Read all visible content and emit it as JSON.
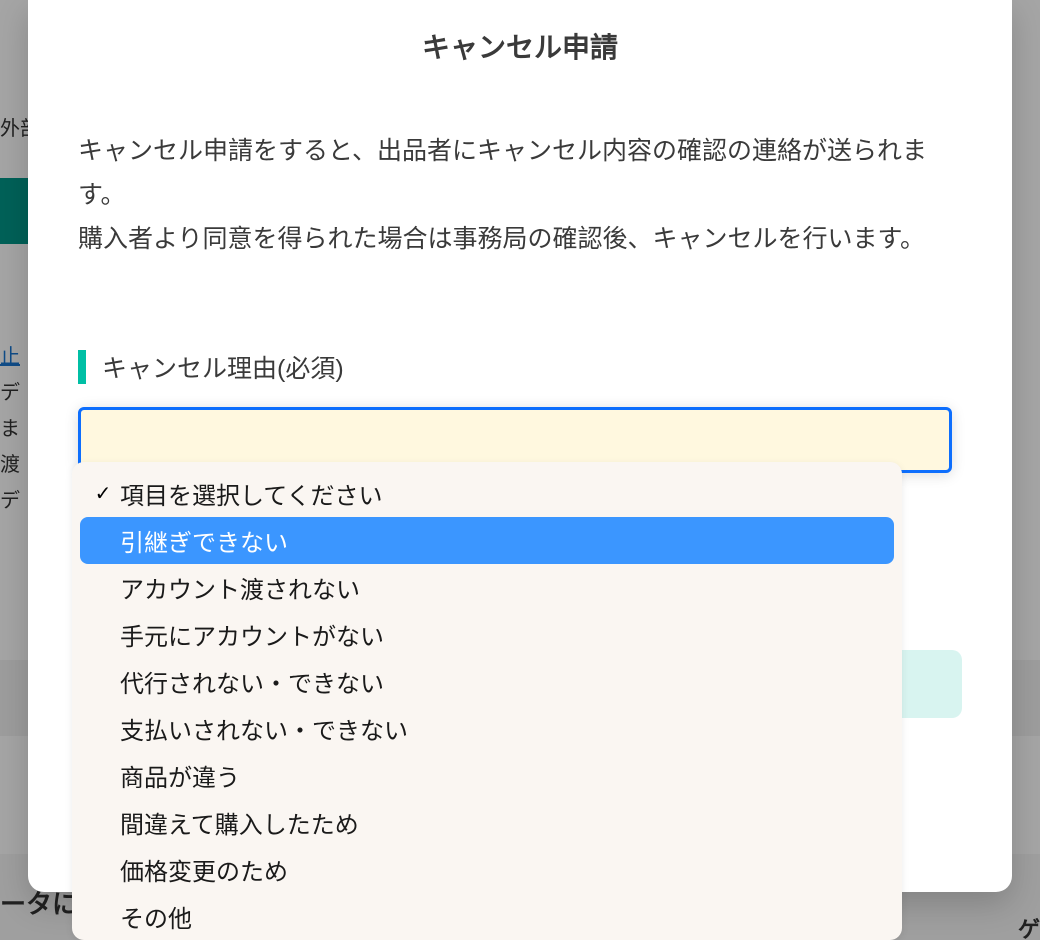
{
  "modal": {
    "title": "キャンセル申請",
    "description_line1": "キャンセル申請をすると、出品者にキャンセル内容の確認の連絡が送られます。",
    "description_line2": "購入者より同意を得られた場合は事務局の確認後、キャンセルを行います。",
    "reason_section_label": "キャンセル理由(必須)"
  },
  "select": {
    "placeholder": "項目を選択してください",
    "selected_index": 0,
    "highlighted_index": 1,
    "options": [
      {
        "label": "項目を選択してください",
        "checked": true
      },
      {
        "label": "引継ぎできない",
        "checked": false
      },
      {
        "label": "アカウント渡されない",
        "checked": false
      },
      {
        "label": "手元にアカウントがない",
        "checked": false
      },
      {
        "label": "代行されない・できない",
        "checked": false
      },
      {
        "label": "支払いされない・できない",
        "checked": false
      },
      {
        "label": "商品が違う",
        "checked": false
      },
      {
        "label": "間違えて購入したため",
        "checked": false
      },
      {
        "label": "価格変更のため",
        "checked": false
      },
      {
        "label": "その他",
        "checked": false
      }
    ]
  },
  "background": {
    "frag_top": "外部",
    "frag_link": "止",
    "frag_lines": [
      "デ",
      "ま",
      "渡",
      "デ"
    ],
    "frag_bottom_left": "ータに",
    "frag_bottom_right": "ゲ"
  },
  "colors": {
    "accent_teal": "#00bfa5",
    "select_border": "#0d6efd",
    "select_bg": "#fff8df",
    "option_highlight": "#3b96ff",
    "option_panel_bg": "#faf6f2"
  }
}
